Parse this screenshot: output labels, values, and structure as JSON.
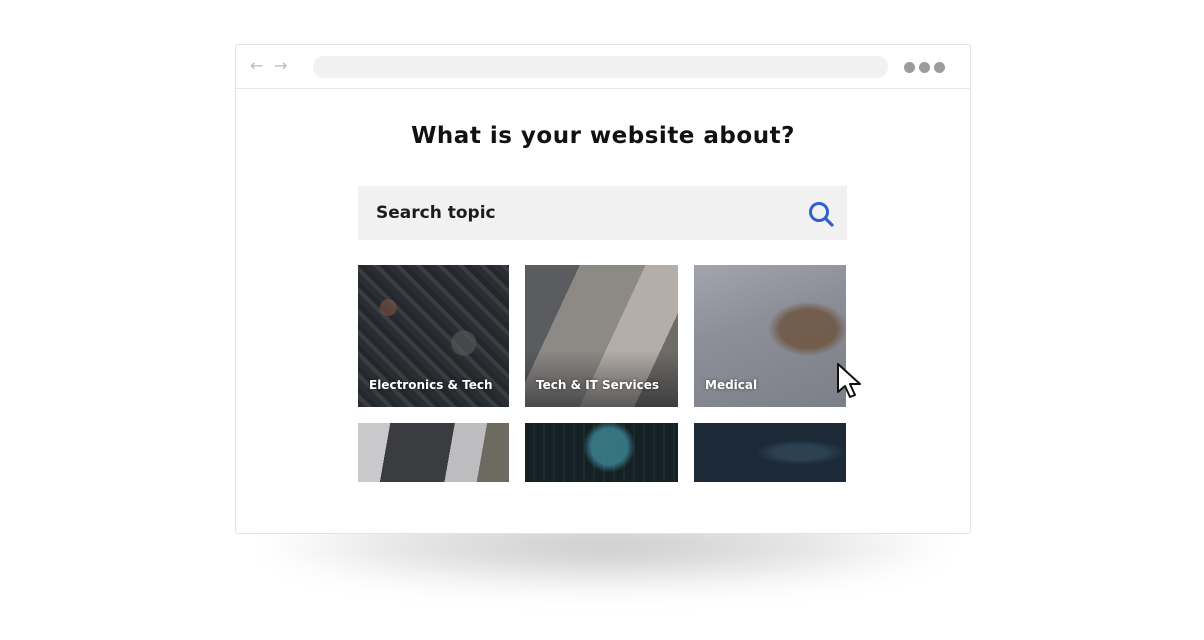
{
  "browser": {
    "back_icon": "arrow-left-icon",
    "forward_icon": "arrow-right-icon",
    "back_glyph": "←",
    "forward_glyph": "→",
    "url": "",
    "menu_icon": "more-dots-icon"
  },
  "page": {
    "title": "What is your website about?",
    "search": {
      "placeholder": "Search topic",
      "value": "",
      "icon": "search-icon",
      "accent_color": "#2f5fd0"
    },
    "topics": [
      {
        "label": "Electronics & Tech"
      },
      {
        "label": "Tech & IT Services"
      },
      {
        "label": "Medical"
      },
      {
        "label": ""
      },
      {
        "label": ""
      },
      {
        "label": ""
      }
    ]
  }
}
